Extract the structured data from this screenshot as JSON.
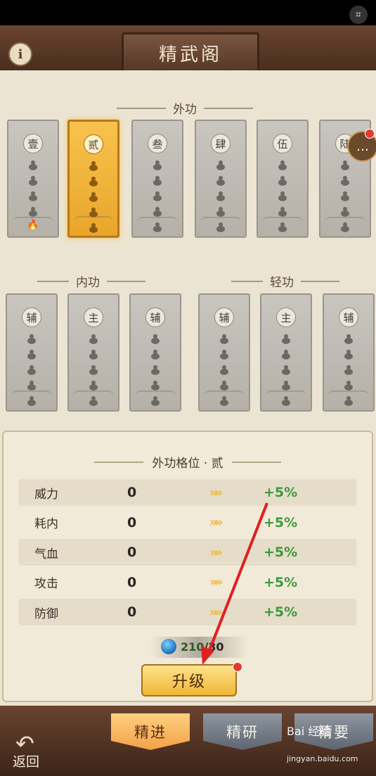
{
  "header": {
    "title": "精武阁",
    "info_icon": "info-icon",
    "scan_icon": "scan-text-icon"
  },
  "sections": {
    "waigong": {
      "title": "外功",
      "cards": [
        {
          "label": "壹",
          "active": false,
          "flame": true
        },
        {
          "label": "贰",
          "active": true,
          "flame": false
        },
        {
          "label": "叁",
          "active": false,
          "flame": false
        },
        {
          "label": "肆",
          "active": false,
          "flame": false
        },
        {
          "label": "伍",
          "active": false,
          "flame": false
        },
        {
          "label": "陆",
          "active": false,
          "flame": false
        }
      ]
    },
    "neigong": {
      "title": "内功",
      "cards": [
        {
          "label": "辅"
        },
        {
          "label": "主"
        },
        {
          "label": "辅"
        }
      ]
    },
    "qinggong": {
      "title": "轻功",
      "cards": [
        {
          "label": "辅"
        },
        {
          "label": "主"
        },
        {
          "label": "辅"
        }
      ]
    }
  },
  "detail": {
    "title": "外功格位 · 贰",
    "stats": [
      {
        "name": "威力",
        "value": "0",
        "bonus": "+5%"
      },
      {
        "name": "耗内",
        "value": "0",
        "bonus": "+5%"
      },
      {
        "name": "气血",
        "value": "0",
        "bonus": "+5%"
      },
      {
        "name": "攻击",
        "value": "0",
        "bonus": "+5%"
      },
      {
        "name": "防御",
        "value": "0",
        "bonus": "+5%"
      }
    ],
    "resource_current": "210",
    "resource_sep": "/",
    "resource_total": "30",
    "upgrade_label": "升级"
  },
  "footer": {
    "back_label": "返回",
    "tabs": [
      {
        "label": "精进",
        "active": true
      },
      {
        "label": "精研",
        "active": false
      },
      {
        "label": "精要",
        "active": false
      }
    ]
  },
  "watermark": {
    "text": "Bai 经验",
    "sub": "jingyan.baidu.com"
  },
  "colors": {
    "active_card": "#f2b53c",
    "bonus_green": "#3c9a3c",
    "annotation_arrow": "#e02020"
  }
}
